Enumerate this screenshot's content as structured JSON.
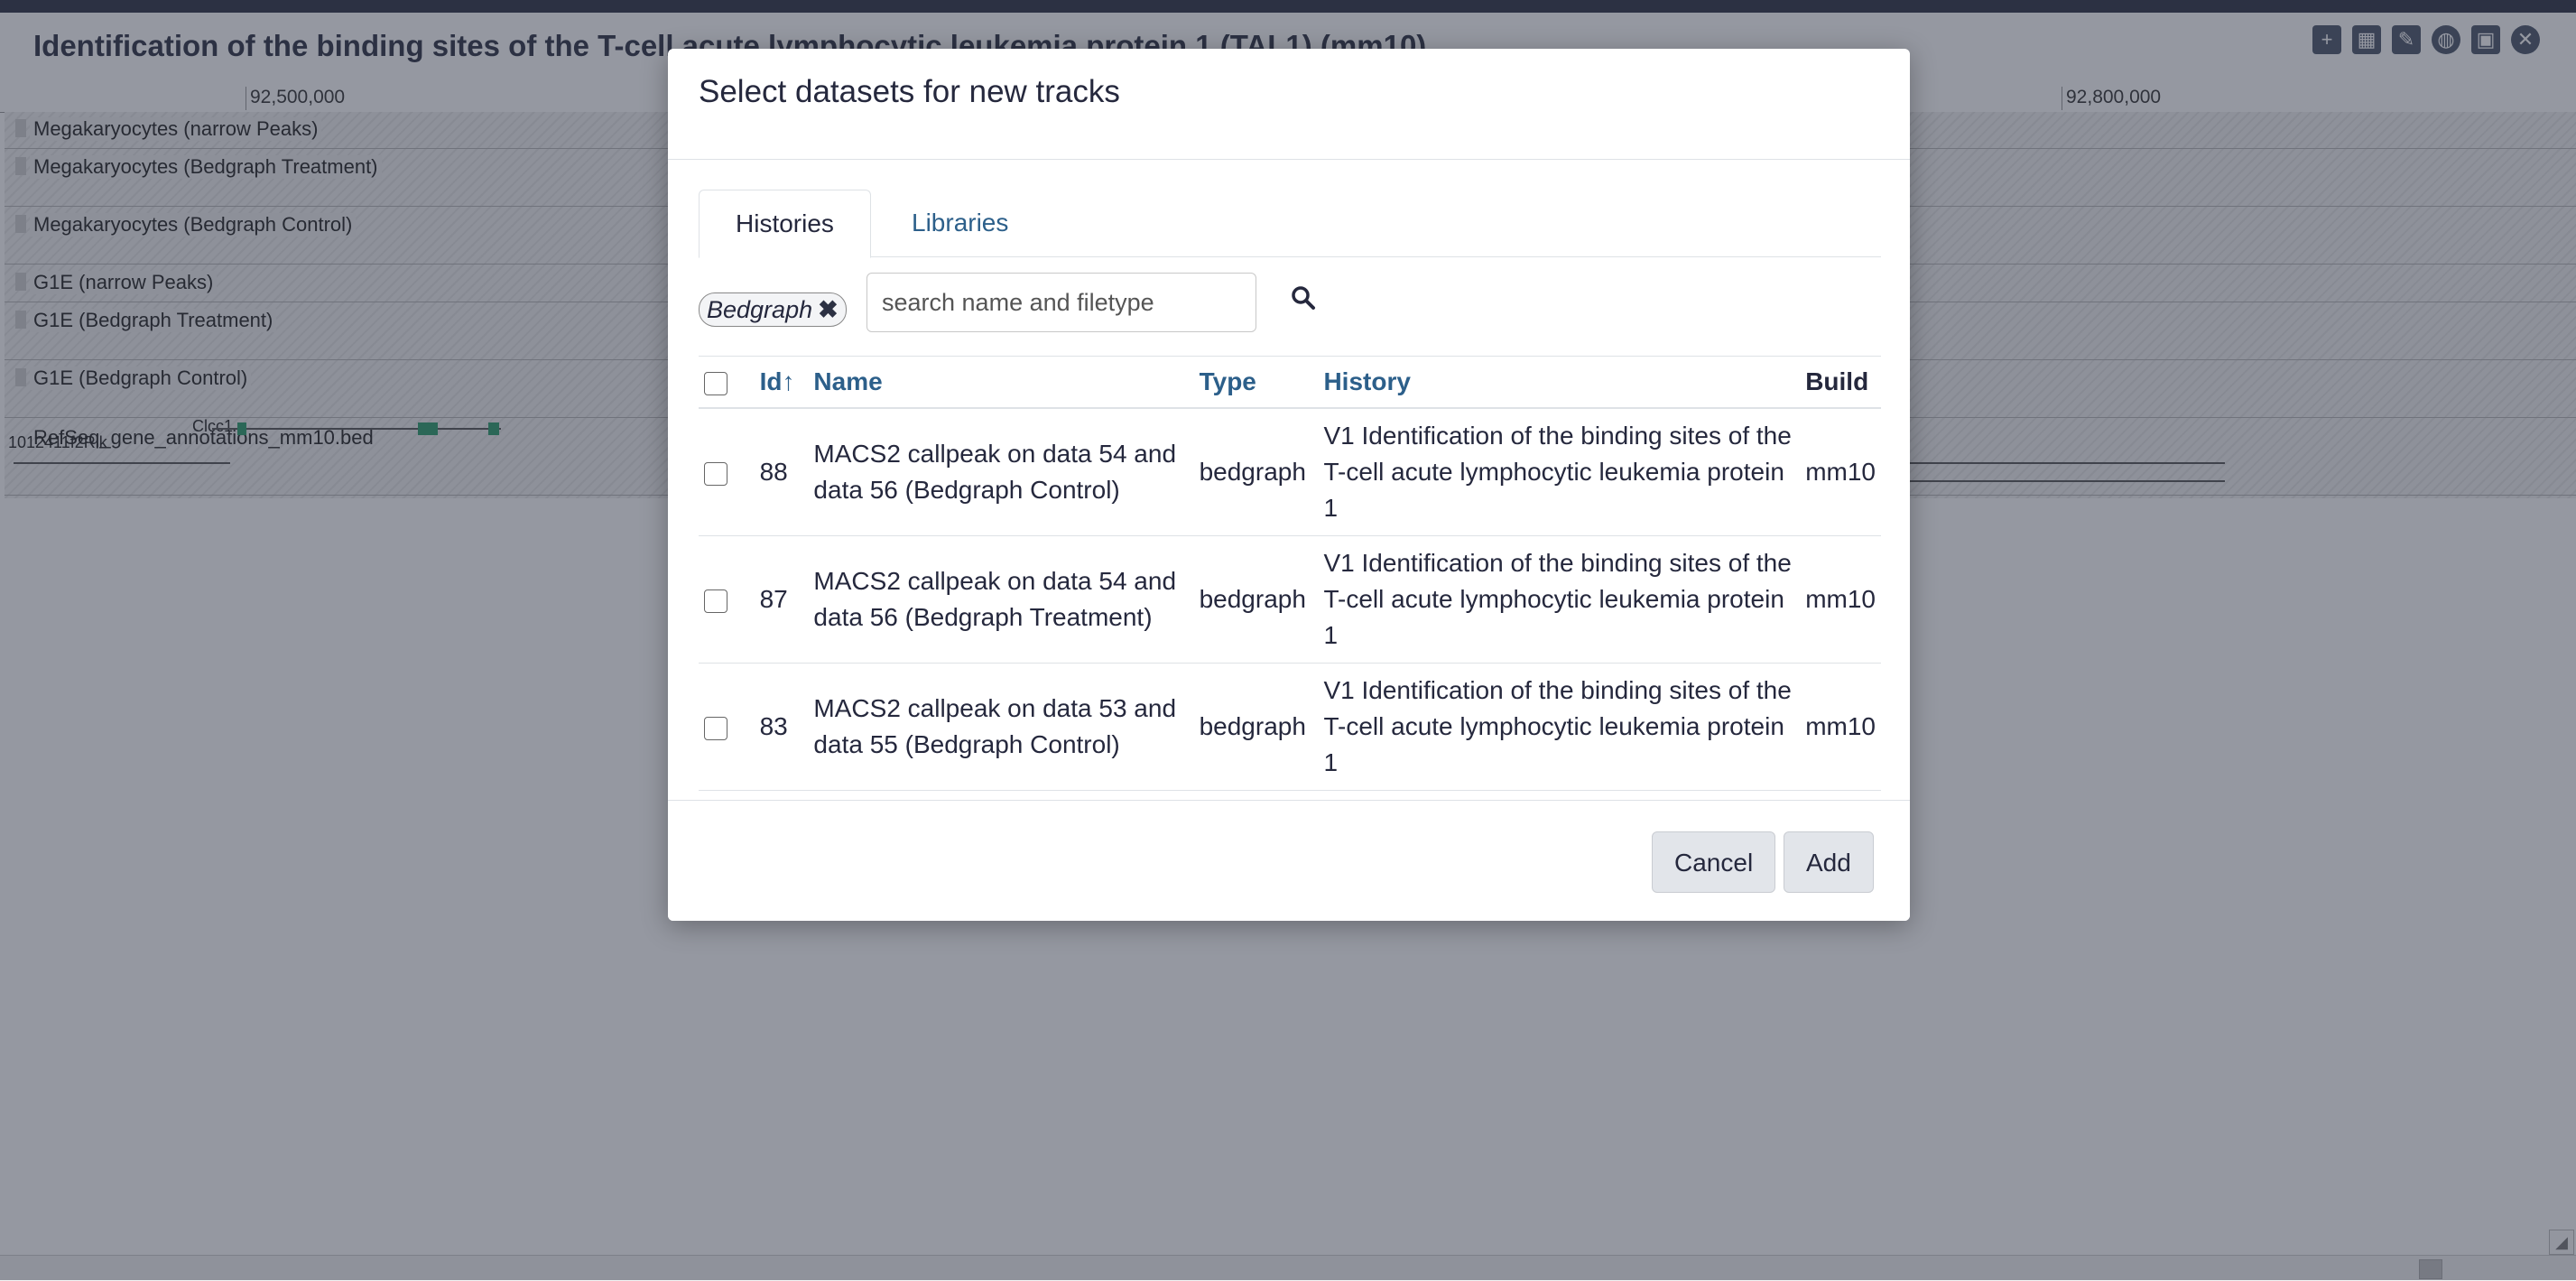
{
  "viz": {
    "title": "Identification of the binding sites of the T-cell acute lymphocytic leukemia protein 1 (TAL1) (mm10)",
    "ruler_ticks": [
      "92,500,000",
      "92,800,000"
    ],
    "tracks": [
      {
        "label": "Megakaryocytes (narrow Peaks)"
      },
      {
        "label": "Megakaryocytes (Bedgraph Treatment)"
      },
      {
        "label": "Megakaryocytes (Bedgraph Control)"
      },
      {
        "label": "G1E (narrow Peaks)"
      },
      {
        "label": "G1E (Bedgraph Treatment)"
      },
      {
        "label": "G1E (Bedgraph Control)"
      },
      {
        "label": "RefSeq_gene_annotations_mm10.bed"
      }
    ],
    "gene_labels": [
      "1012411f2Rik",
      "Clcc1"
    ],
    "toolbar_icons": [
      "add-track-icon",
      "add-group-icon",
      "bookmark-icon",
      "globe-icon",
      "save-icon",
      "close-icon"
    ]
  },
  "modal": {
    "title": "Select datasets for new tracks",
    "tabs": [
      {
        "label": "Histories",
        "active": true
      },
      {
        "label": "Libraries",
        "active": false
      }
    ],
    "filter_chip": "Bedgraph",
    "search": {
      "placeholder": "search name and filetype",
      "value": ""
    },
    "table": {
      "columns": [
        "Id↑",
        "Name",
        "Type",
        "History",
        "Build"
      ],
      "rows": [
        {
          "id": "88",
          "name": "MACS2 callpeak on data 54 and data 56 (Bedgraph Control)",
          "type": "bedgraph",
          "history": "V1 Identification of the binding sites of the T-cell acute lymphocytic leukemia protein 1",
          "build": "mm10"
        },
        {
          "id": "87",
          "name": "MACS2 callpeak on data 54 and data 56 (Bedgraph Treatment)",
          "type": "bedgraph",
          "history": "V1 Identification of the binding sites of the T-cell acute lymphocytic leukemia protein 1",
          "build": "mm10"
        },
        {
          "id": "83",
          "name": "MACS2 callpeak on data 53 and data 55 (Bedgraph Control)",
          "type": "bedgraph",
          "history": "V1 Identification of the binding sites of the T-cell acute lymphocytic leukemia protein 1",
          "build": "mm10"
        }
      ]
    },
    "buttons": {
      "cancel": "Cancel",
      "add": "Add"
    }
  }
}
